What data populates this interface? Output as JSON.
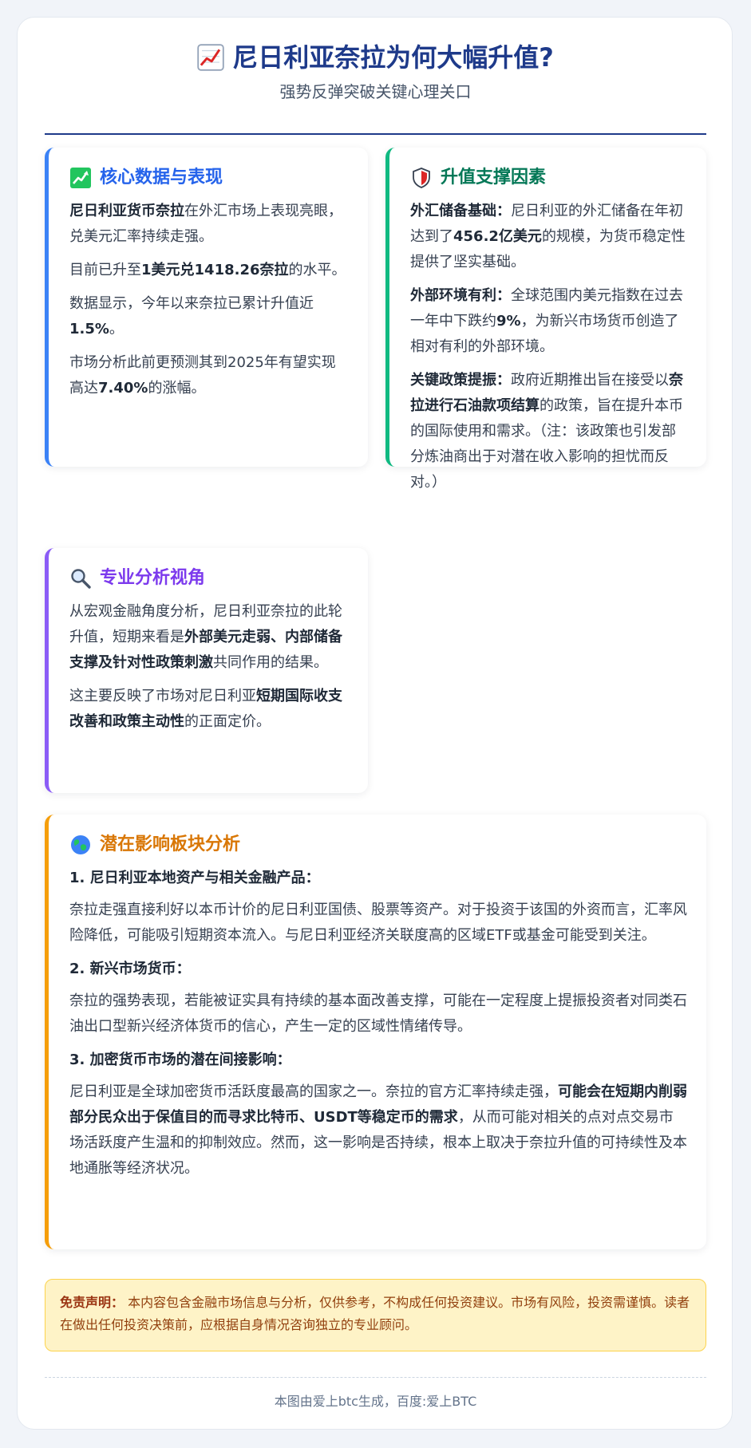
{
  "header": {
    "icon": "chart-increasing-icon",
    "title": "尼日利亚奈拉为何大幅升值?",
    "subtitle": "强势反弹突破关键心理关口"
  },
  "core": {
    "icon": "chart-up-green-icon",
    "title": "核心数据与表现",
    "p1": {
      "b1": "尼日利亚货币奈拉",
      "t1": "在外汇市场上表现亮眼，兑美元汇率持续走强。"
    },
    "p2": {
      "t1": "目前已升至",
      "b1": "1美元兑1418.26奈拉",
      "t2": "的水平。"
    },
    "p3": {
      "t1": "数据显示，今年以来奈拉已累计升值近",
      "b1": "1.5%",
      "t2": "。"
    },
    "p4": {
      "t1": "市场分析此前更预测其到2025年有望实现高达",
      "b1": "7.40%",
      "t2": "的涨幅。"
    }
  },
  "support": {
    "icon": "shield-icon",
    "title": "升值支撑因素",
    "p1": {
      "b1": "外汇储备基础：",
      "t1": "尼日利亚的外汇储备在年初达到了",
      "b2": "456.2亿美元",
      "t2": "的规模，为货币稳定性提供了坚实基础。"
    },
    "p2": {
      "b1": "外部环境有利：",
      "t1": "全球范围内美元指数在过去一年中下跌约",
      "b2": "9%",
      "t2": "，为新兴市场货币创造了相对有利的外部环境。"
    },
    "p3": {
      "b1": "关键政策提振：",
      "t1": "政府近期推出旨在接受以",
      "b2": "奈拉进行石油款项结算",
      "t2": "的政策，旨在提升本币的国际使用和需求。（注：该政策也引发部分炼油商出于对潜在收入影响的担忧而反对。）"
    }
  },
  "analysis": {
    "icon": "magnifier-icon",
    "title": "专业分析视角",
    "p1": {
      "t1": "从宏观金融角度分析，尼日利亚奈拉的此轮升值，短期来看是",
      "b1": "外部美元走弱、内部储备支撑及针对性政策刺激",
      "t2": "共同作用的结果。"
    },
    "p2": {
      "t1": "这主要反映了市场对尼日利亚",
      "b1": "短期国际收支改善和政策主动性",
      "t2": "的正面定价。"
    }
  },
  "impact": {
    "icon": "globe-icon",
    "title": "潜在影响板块分析",
    "h1": "1. 尼日利亚本地资产与相关金融产品：",
    "t1": "奈拉走强直接利好以本币计价的尼日利亚国债、股票等资产。对于投资于该国的外资而言，汇率风险降低，可能吸引短期资本流入。与尼日利亚经济关联度高的区域ETF或基金可能受到关注。",
    "h2": "2. 新兴市场货币：",
    "t2": "奈拉的强势表现，若能被证实具有持续的基本面改善支撑，可能在一定程度上提振投资者对同类石油出口型新兴经济体货币的信心，产生一定的区域性情绪传导。",
    "h3": "3. 加密货币市场的潜在间接影响：",
    "t3a": "尼日利亚是全球加密货币活跃度最高的国家之一。奈拉的官方汇率持续走强，",
    "b3": "可能会在短期内削弱部分民众出于保值目的而寻求比特币、USDT等稳定币的需求",
    "t3b": "，从而可能对相关的点对点交易市场活跃度产生温和的抑制效应。然而，这一影响是否持续，根本上取决于奈拉升值的可持续性及本地通胀等经济状况。"
  },
  "disclaimer": {
    "label": "免责声明：",
    "text": " 本内容包含金融市场信息与分析，仅供参考，不构成任何投资建议。市场有风险，投资需谨慎。读者在做出任何投资决策前，应根据自身情况咨询独立的专业顾问。"
  },
  "footer": {
    "text": "本图由爱上btc生成，百度:爱上BTC"
  },
  "colors": {
    "title": "#1e3a8a",
    "blue": "#3b82f6",
    "green": "#10b981",
    "purple": "#8b5cf6",
    "orange": "#f59e0b",
    "disclaimer_bg": "#fef3c7"
  }
}
